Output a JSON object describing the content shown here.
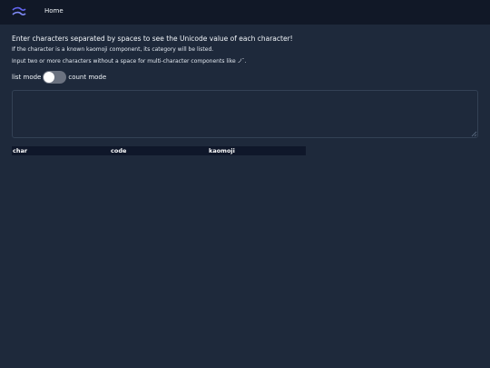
{
  "nav": {
    "home_label": "Home"
  },
  "instructions": {
    "line1": "Enter characters separated by spaces to see the Unicode value of each character!",
    "line2": "If the character is a known kaomoji component, its category will be listed.",
    "line3": "Input two or more characters without a space for multi-character components like ノ ̄."
  },
  "mode": {
    "left_label": "list mode",
    "right_label": "count mode",
    "count_mode_on": false
  },
  "textarea": {
    "value": ""
  },
  "table": {
    "columns": [
      "char",
      "code",
      "kaomoji"
    ]
  },
  "colors": {
    "background": "#1e293b",
    "topbar": "#111827",
    "table_header": "#0f172a",
    "logo": "#6366f1"
  },
  "icons": {
    "logo": "wave-logo-icon"
  }
}
